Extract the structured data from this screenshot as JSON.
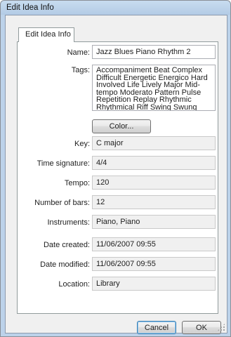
{
  "window": {
    "title": "Edit Idea Info"
  },
  "tabs": [
    {
      "label": "Edit Idea Info"
    }
  ],
  "fields": {
    "name": {
      "label": "Name:",
      "value": "Jazz Blues Piano Rhythm 2"
    },
    "tags": {
      "label": "Tags:",
      "value": "Accompaniment Beat Complex Difficult Energetic Energico Hard Involved Life Lively Major Mid-tempo Moderato Pattern Pulse Repetition Replay Rhythmic Rhythmical Riff Swing Swung"
    },
    "key": {
      "label": "Key:",
      "value": "C major"
    },
    "time_signature": {
      "label": "Time signature:",
      "value": "4/4"
    },
    "tempo": {
      "label": "Tempo:",
      "value": "120"
    },
    "number_of_bars": {
      "label": "Number of bars:",
      "value": "12"
    },
    "instruments": {
      "label": "Instruments:",
      "value": "Piano, Piano"
    },
    "date_created": {
      "label": "Date created:",
      "value": "11/06/2007 09:55"
    },
    "date_modified": {
      "label": "Date modified:",
      "value": "11/06/2007 09:55"
    },
    "location": {
      "label": "Location:",
      "value": "Library"
    }
  },
  "buttons": {
    "color": "Color...",
    "cancel": "Cancel",
    "ok": "OK"
  }
}
